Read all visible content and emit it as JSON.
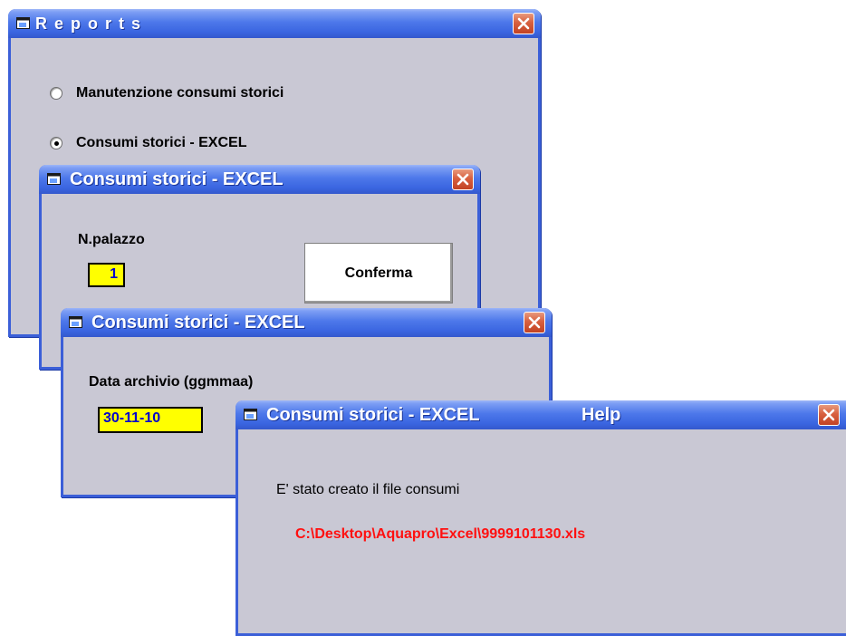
{
  "reports_window": {
    "title": "Reports",
    "options": [
      {
        "label": "Manutenzione consumi storici",
        "selected": false
      },
      {
        "label": "Consumi storici - EXCEL",
        "selected": true
      }
    ]
  },
  "palazzo_window": {
    "title": "Consumi storici - EXCEL",
    "field_label": "N.palazzo",
    "field_value": "1",
    "confirm_label": "Conferma"
  },
  "date_window": {
    "title": "Consumi storici - EXCEL",
    "field_label": "Data archivio (ggmmaa)",
    "field_value": "30-11-10"
  },
  "message_window": {
    "title": "Consumi storici - EXCEL",
    "help_label": "Help",
    "message": "E' stato creato il file consumi",
    "file_path": "C:\\Desktop\\Aquapro\\Excel\\9999101130.xls"
  },
  "colors": {
    "window_bg": "#c9c8d4",
    "titlebar_blue": "#3a65e0",
    "field_yellow": "#ffff00",
    "field_text": "#0000cc",
    "path_red": "#ff1010",
    "close_red": "#d8603f"
  },
  "icons": {
    "title_icon": "app-window-icon",
    "close": "close-icon",
    "radio": "radio-icon"
  }
}
